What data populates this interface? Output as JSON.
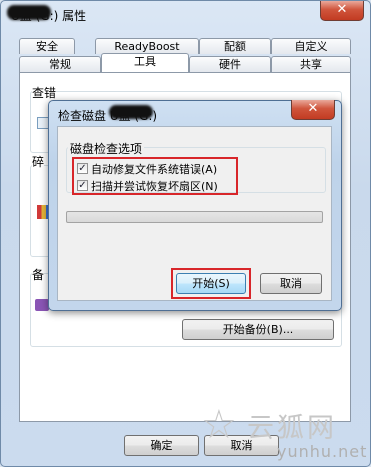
{
  "window": {
    "title": "U盘 (G:) 属性",
    "close_glyph": "✕"
  },
  "tabs": {
    "row1": [
      "安全",
      "ReadyBoost",
      "配额",
      "自定义"
    ],
    "row2": [
      "常规",
      "工具",
      "硬件",
      "共享"
    ],
    "active": "工具"
  },
  "tools_panel": {
    "check_label": "查错",
    "defrag_label": "碎",
    "backup_label": "备",
    "backup_button": "开始备份(B)..."
  },
  "dialog": {
    "title": "检查磁盘 U盘 (G:)",
    "close_glyph": "✕",
    "options_group": "磁盘检查选项",
    "options": [
      {
        "label": "自动修复文件系统错误(A)",
        "checked": true
      },
      {
        "label": "扫描并尝试恢复坏扇区(N)",
        "checked": true
      }
    ],
    "check_mark": "✓",
    "progress": 0,
    "start_button": "开始(S)",
    "cancel_button": "取消"
  },
  "footer": {
    "ok_button": "确定",
    "cancel_button": "取消"
  },
  "watermark": {
    "main": "云狐网",
    "sub": "yunhu.net"
  },
  "colors": {
    "highlight": "#d8262a"
  }
}
